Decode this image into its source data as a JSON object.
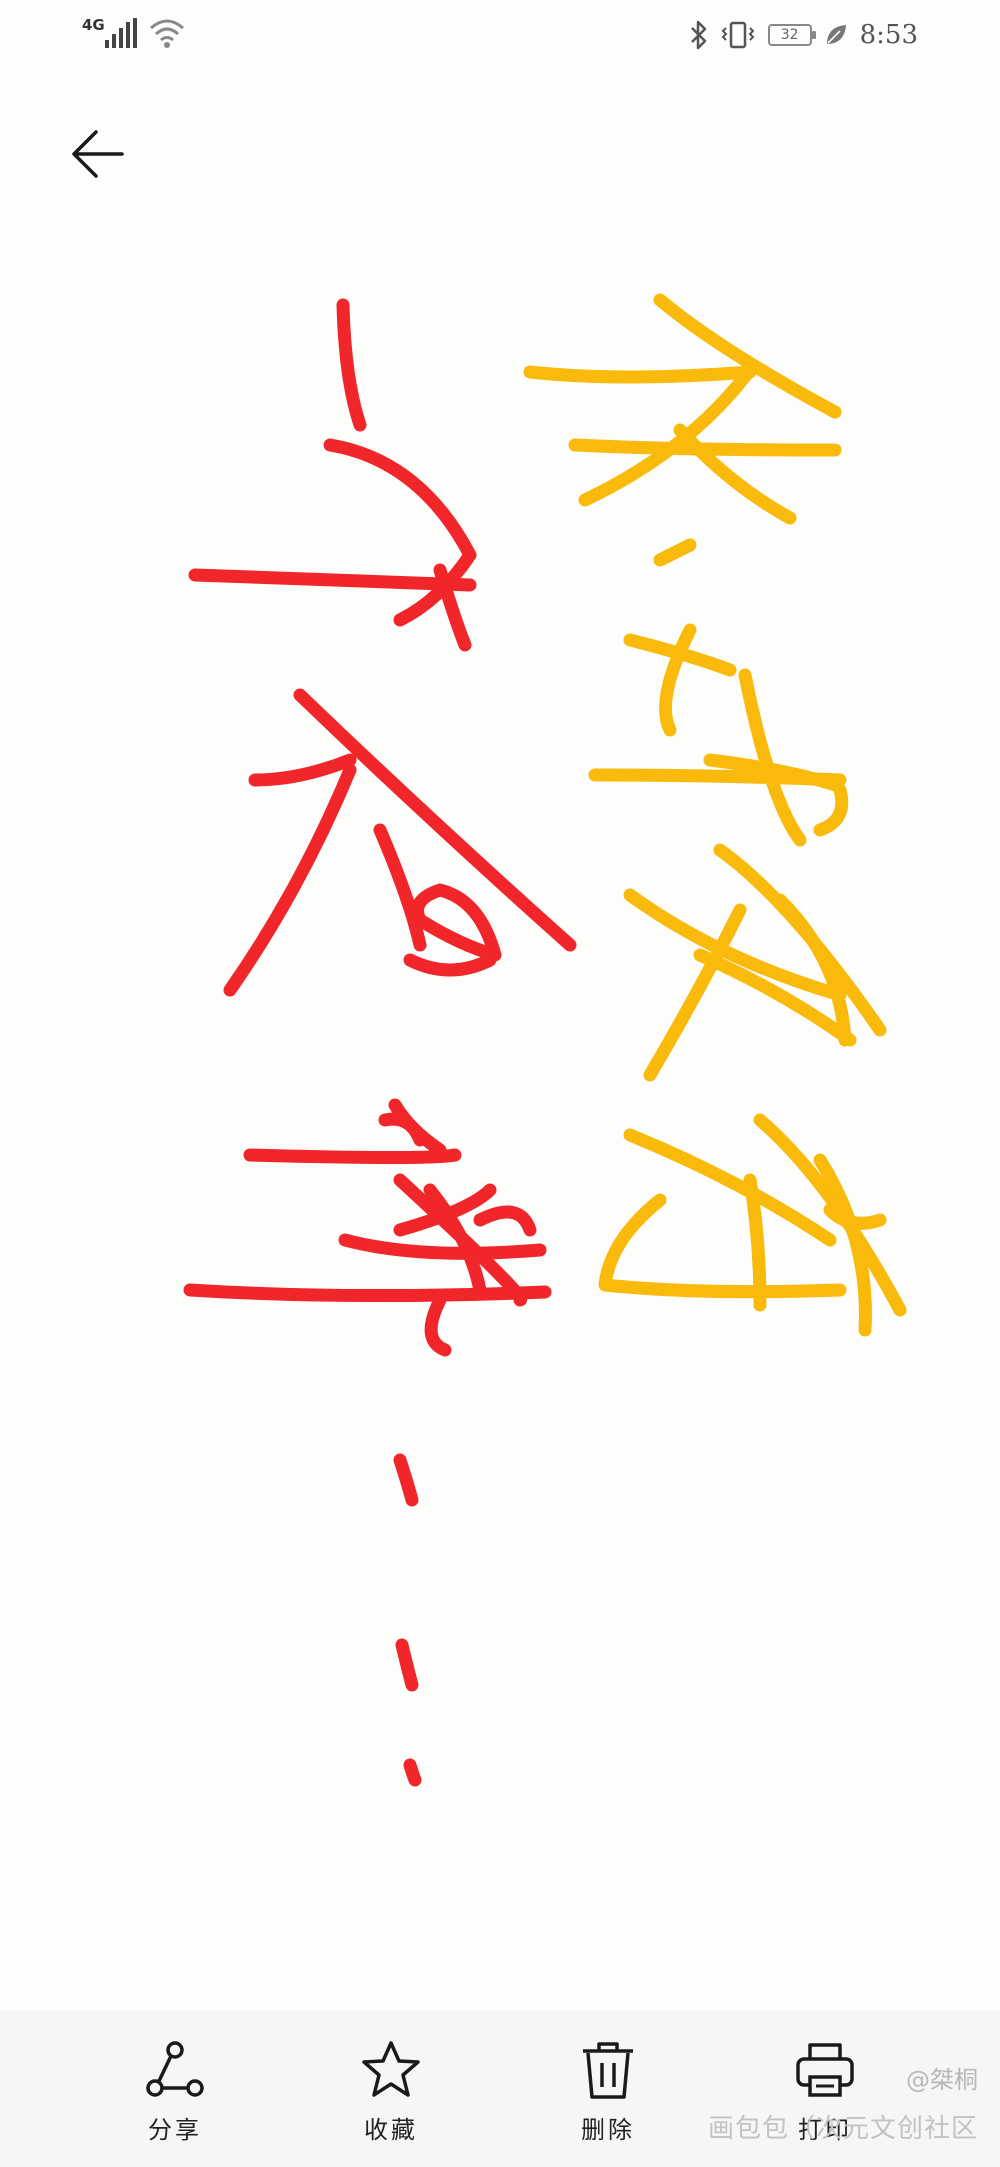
{
  "status_bar": {
    "network_type": "4G",
    "battery_level": "32",
    "time": "8:53"
  },
  "navigation": {
    "back_icon": "arrow-left-icon"
  },
  "toolbar": {
    "items": [
      {
        "label": "分享",
        "icon": "share-icon"
      },
      {
        "label": "收藏",
        "icon": "star-icon"
      },
      {
        "label": "删除",
        "icon": "trash-icon"
      },
      {
        "label": "打印",
        "icon": "printer-icon"
      }
    ]
  },
  "watermark": {
    "handle": "@桀桐",
    "site": "画包包（次元文创社区"
  },
  "colors": {
    "handwriting_yellow": "#F9BA0C",
    "handwriting_red": "#F0262B",
    "background": "#FDFDFC",
    "toolbar_bg": "#F6F6F6",
    "icon": "#1A1A1A"
  }
}
